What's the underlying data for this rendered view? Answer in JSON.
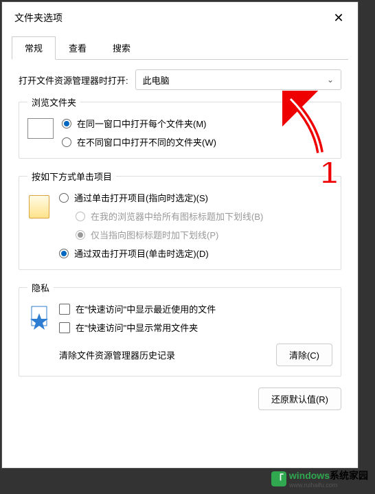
{
  "dialog": {
    "title": "文件夹选项",
    "close": "✕"
  },
  "tabs": {
    "general": "常规",
    "view": "查看",
    "search": "搜索"
  },
  "open_with": {
    "label": "打开文件资源管理器时打开:",
    "value": "此电脑"
  },
  "browse": {
    "legend": "浏览文件夹",
    "opt1": "在同一窗口中打开每个文件夹(M)",
    "opt2": "在不同窗口中打开不同的文件夹(W)"
  },
  "click": {
    "legend": "按如下方式单击项目",
    "opt1": "通过单击打开项目(指向时选定)(S)",
    "opt1a": "在我的浏览器中给所有图标标题加下划线(B)",
    "opt1b": "仅当指向图标标题时加下划线(P)",
    "opt2": "通过双击打开项目(单击时选定)(D)"
  },
  "privacy": {
    "legend": "隐私",
    "chk1": "在\"快速访问\"中显示最近使用的文件",
    "chk2": "在\"快速访问\"中显示常用文件夹",
    "clear_label": "清除文件资源管理器历史记录",
    "clear_btn": "清除(C)"
  },
  "restore_btn": "还原默认值(R)",
  "annotation": {
    "number": "1"
  },
  "watermark": {
    "logo_letter": "「",
    "brand": "windows",
    "sub": "www.ruihaifu.com",
    "suffix": "系统家园"
  }
}
